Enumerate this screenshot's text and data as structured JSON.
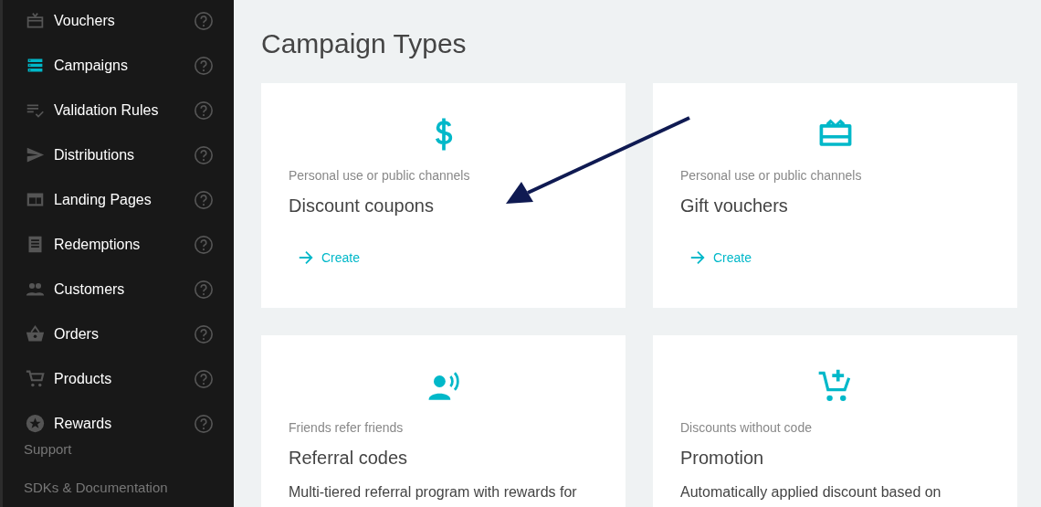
{
  "sidebar": {
    "items": [
      {
        "label": "Vouchers",
        "selected": false
      },
      {
        "label": "Campaigns",
        "selected": true
      },
      {
        "label": "Validation Rules",
        "selected": false
      },
      {
        "label": "Distributions",
        "selected": false
      },
      {
        "label": "Landing Pages",
        "selected": false
      },
      {
        "label": "Redemptions",
        "selected": false
      },
      {
        "label": "Customers",
        "selected": false
      },
      {
        "label": "Orders",
        "selected": false
      },
      {
        "label": "Products",
        "selected": false
      },
      {
        "label": "Rewards",
        "selected": false
      }
    ],
    "links": [
      "Support",
      "SDKs & Documentation"
    ]
  },
  "page_title": "Campaign Types",
  "cards": [
    {
      "subtitle": "Personal use or public channels",
      "title": "Discount coupons",
      "action": "Create"
    },
    {
      "subtitle": "Personal use or public channels",
      "title": "Gift vouchers",
      "action": "Create"
    },
    {
      "subtitle": "Friends refer friends",
      "title": "Referral codes",
      "description": "Multi-tiered referral program with rewards for"
    },
    {
      "subtitle": "Discounts without code",
      "title": "Promotion",
      "description": "Automatically applied discount based on"
    }
  ]
}
